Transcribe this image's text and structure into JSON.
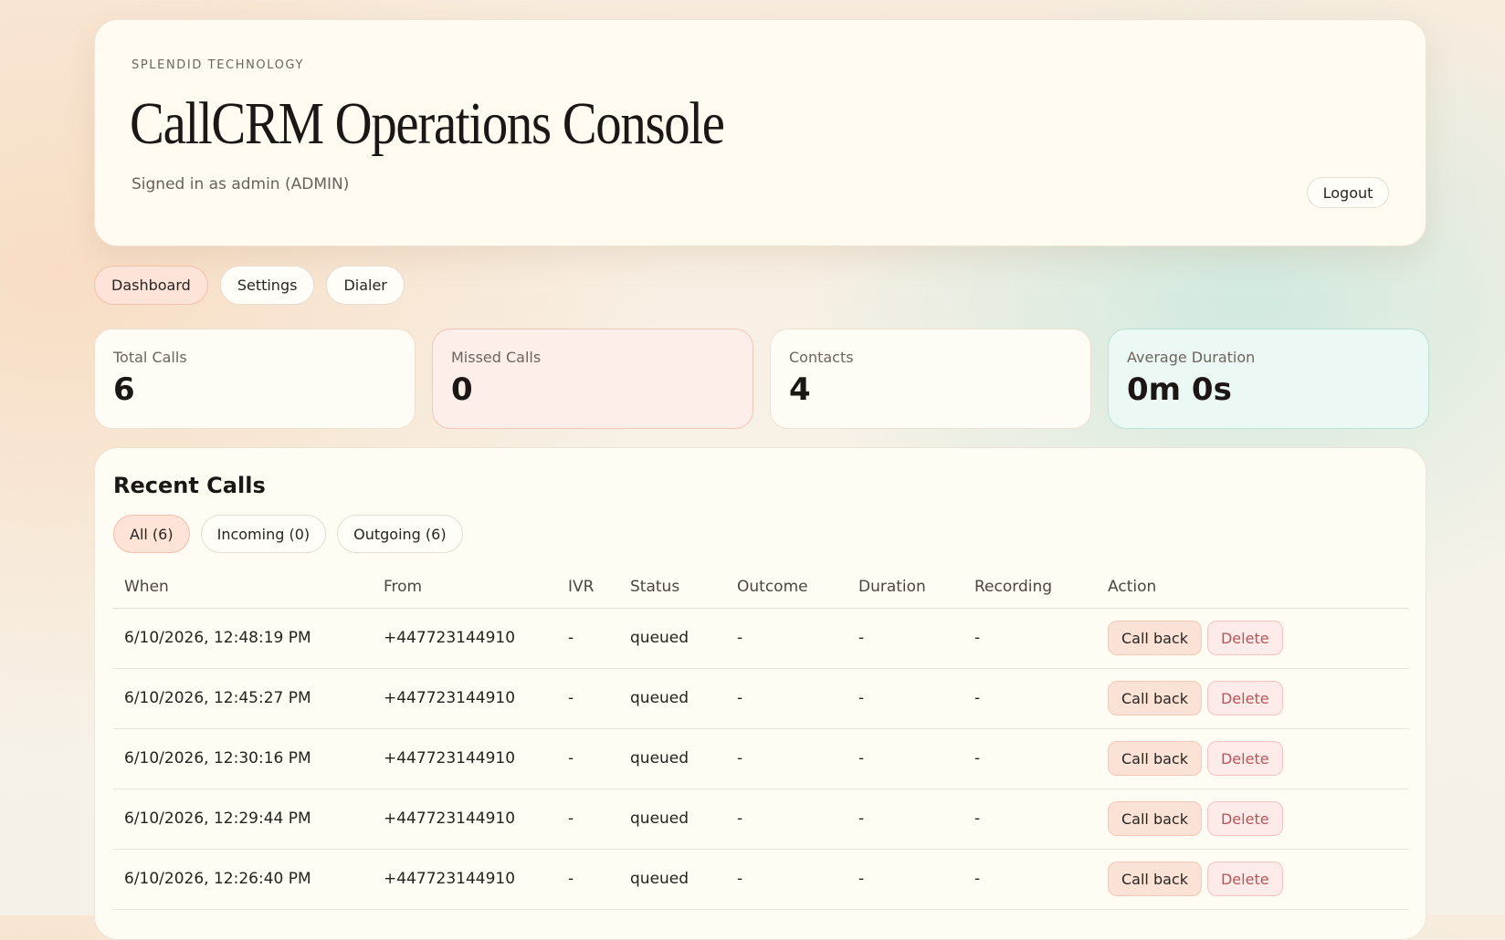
{
  "header": {
    "eyebrow": "SPLENDID TECHNOLOGY",
    "title": "CallCRM Operations Console",
    "signed_in": "Signed in as admin (ADMIN)",
    "logout_label": "Logout"
  },
  "nav": {
    "items": [
      {
        "label": "Dashboard",
        "active": true
      },
      {
        "label": "Settings",
        "active": false
      },
      {
        "label": "Dialer",
        "active": false
      }
    ]
  },
  "stats": [
    {
      "label": "Total Calls",
      "value": "6"
    },
    {
      "label": "Missed Calls",
      "value": "0"
    },
    {
      "label": "Contacts",
      "value": "4"
    },
    {
      "label": "Average Duration",
      "value": "0m 0s"
    }
  ],
  "recent_calls": {
    "title": "Recent Calls",
    "filters": [
      {
        "label": "All (6)",
        "active": true
      },
      {
        "label": "Incoming (0)",
        "active": false
      },
      {
        "label": "Outgoing (6)",
        "active": false
      }
    ],
    "columns": [
      "When",
      "From",
      "IVR",
      "Status",
      "Outcome",
      "Duration",
      "Recording",
      "Action"
    ],
    "actions": {
      "call_back": "Call back",
      "delete": "Delete"
    },
    "rows": [
      {
        "when": "6/10/2026, 12:48:19 PM",
        "from": "+447723144910",
        "ivr": "-",
        "status": "queued",
        "outcome": "-",
        "duration": "-",
        "recording": "-"
      },
      {
        "when": "6/10/2026, 12:45:27 PM",
        "from": "+447723144910",
        "ivr": "-",
        "status": "queued",
        "outcome": "-",
        "duration": "-",
        "recording": "-"
      },
      {
        "when": "6/10/2026, 12:30:16 PM",
        "from": "+447723144910",
        "ivr": "-",
        "status": "queued",
        "outcome": "-",
        "duration": "-",
        "recording": "-"
      },
      {
        "when": "6/10/2026, 12:29:44 PM",
        "from": "+447723144910",
        "ivr": "-",
        "status": "queued",
        "outcome": "-",
        "duration": "-",
        "recording": "-"
      },
      {
        "when": "6/10/2026, 12:26:40 PM",
        "from": "+447723144910",
        "ivr": "-",
        "status": "queued",
        "outcome": "-",
        "duration": "-",
        "recording": "-"
      }
    ]
  },
  "colors": {
    "accent_pill": "#fde3d8",
    "missed_card": "#fdeeea",
    "avg_card": "#ecf8f3",
    "delete_text": "#b5565a"
  }
}
